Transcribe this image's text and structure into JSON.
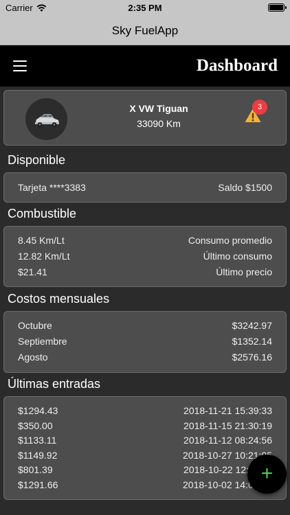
{
  "status_bar": {
    "carrier": "Carrier",
    "time": "2:35 PM"
  },
  "nav": {
    "title": "Sky FuelApp"
  },
  "header": {
    "title": "Dashboard"
  },
  "vehicle": {
    "name": "X VW Tiguan",
    "km": "33090 Km",
    "alert_count": "3"
  },
  "disponible": {
    "title": "Disponible",
    "card": "Tarjeta ****3383",
    "saldo": "Saldo $1500"
  },
  "combustible": {
    "title": "Combustible",
    "rows": [
      {
        "value": "8.45 Km/Lt",
        "label": "Consumo promedio"
      },
      {
        "value": "12.82 Km/Lt",
        "label": "Último consumo"
      },
      {
        "value": "$21.41",
        "label": "Último precio"
      }
    ]
  },
  "costos": {
    "title": "Costos mensuales",
    "rows": [
      {
        "month": "Octubre",
        "amount": "$3242.97"
      },
      {
        "month": "Septiembre",
        "amount": "$1352.14"
      },
      {
        "month": "Agosto",
        "amount": "$2576.16"
      }
    ]
  },
  "entradas": {
    "title": "Últimas entradas",
    "rows": [
      {
        "amount": "$1294.43",
        "date": "2018-11-21 15:39:33"
      },
      {
        "amount": "$350.00",
        "date": "2018-11-15 21:30:19"
      },
      {
        "amount": "$1133.11",
        "date": "2018-11-12 08:24:56"
      },
      {
        "amount": "$1149.92",
        "date": "2018-10-27 10:21:05"
      },
      {
        "amount": "$801.39",
        "date": "2018-10-22 12:27:11"
      },
      {
        "amount": "$1291.66",
        "date": "2018-10-02 14:00:48"
      }
    ]
  },
  "fab": {
    "label": "+"
  },
  "colors": {
    "background": "#2b2b2b",
    "card": "#4d4d4d",
    "alert": "#ee3d42",
    "warning": "#f2b33d",
    "fab_plus": "#4ed14e"
  }
}
